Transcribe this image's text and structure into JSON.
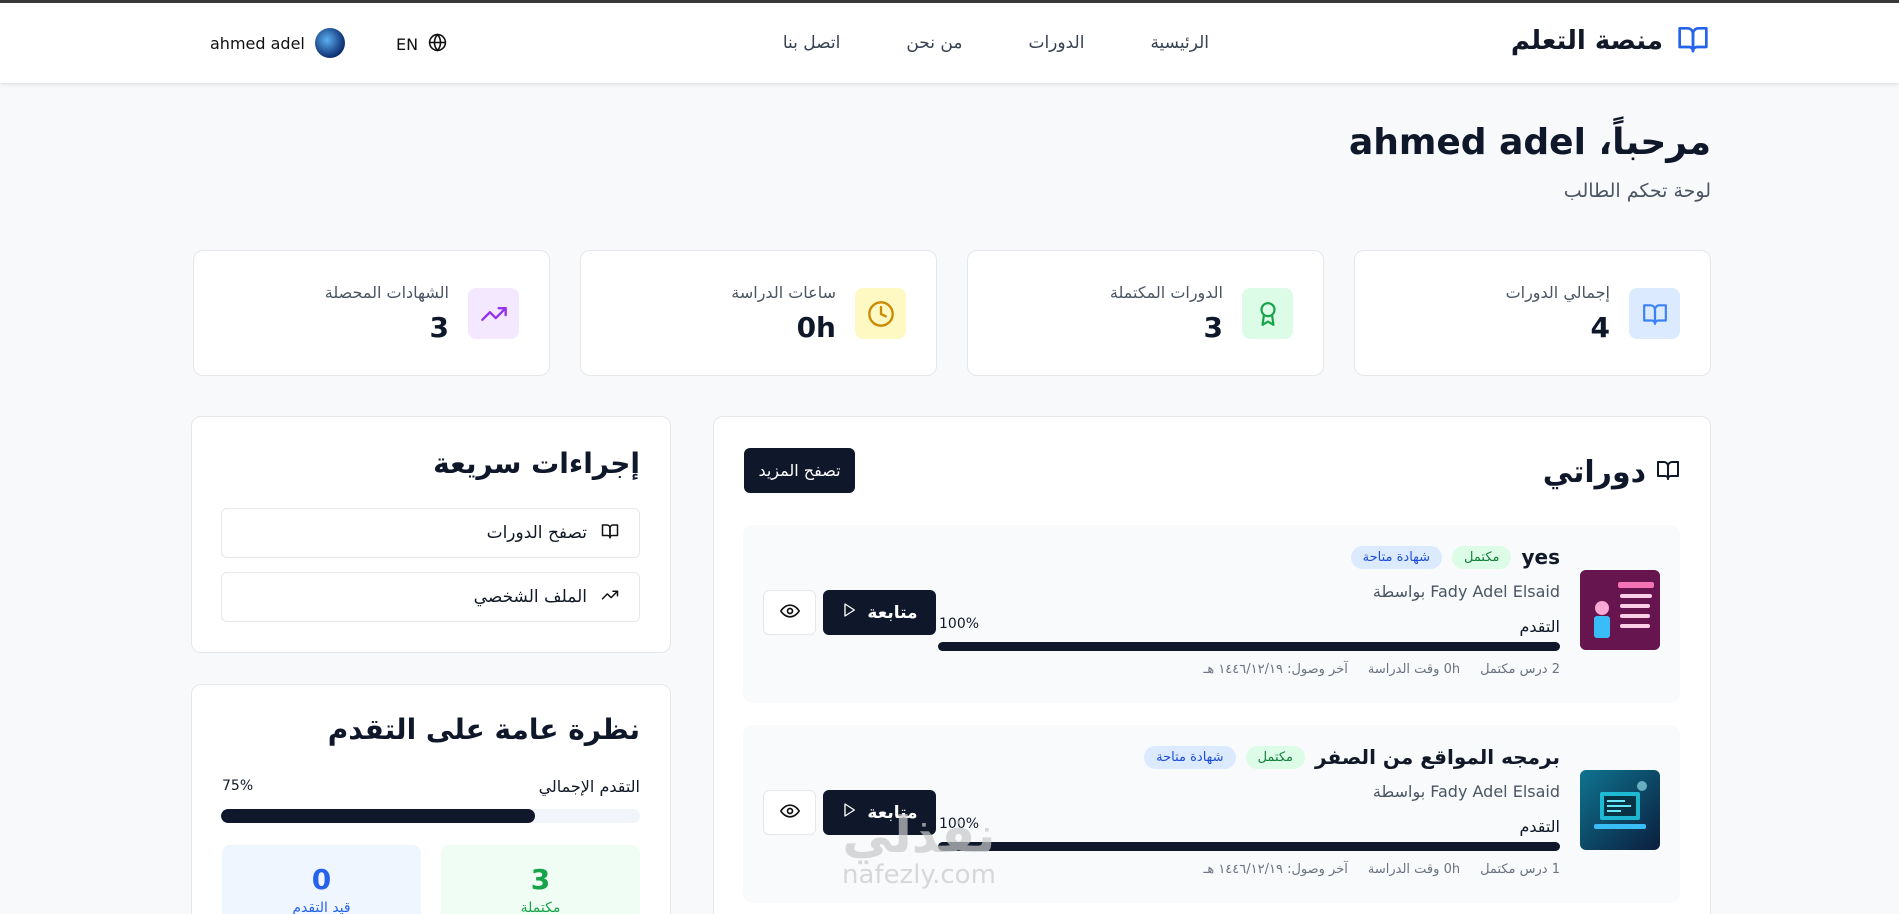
{
  "header": {
    "logo_text": "منصة التعلم",
    "nav": [
      "الرئيسية",
      "الدورات",
      "من نحن",
      "اتصل بنا"
    ],
    "lang": "EN",
    "user_name": "ahmed adel"
  },
  "welcome": {
    "title": "مرحباً، ahmed adel",
    "subtitle": "لوحة تحكم الطالب"
  },
  "stats": [
    {
      "label": "إجمالي الدورات",
      "value": "4",
      "icon": "book-open-icon",
      "color": "#3b82f6"
    },
    {
      "label": "الدورات المكتملة",
      "value": "3",
      "icon": "award-icon",
      "color": "#16a34a"
    },
    {
      "label": "ساعات الدراسة",
      "value": "0h",
      "icon": "clock-icon",
      "color": "#ca8a04"
    },
    {
      "label": "الشهادات المحصلة",
      "value": "3",
      "icon": "trending-up-icon",
      "color": "#9333ea"
    }
  ],
  "courses": {
    "title": "دوراتي",
    "browse_more": "تصفح المزيد",
    "items": [
      {
        "title": "yes",
        "status": "مكتمل",
        "certificate": "شهادة متاحة",
        "instructor": "بواسطة Fady Adel Elsaid",
        "progress_label": "التقدم",
        "progress_text": "100%",
        "progress": 1.0,
        "lessons": "2 درس مكتمل",
        "study_time": "0h وقت الدراسة",
        "last_access": "آخر وصول: ١٤٤٦/١٢/١٩ هـ",
        "follow_label": "متابعة"
      },
      {
        "title": "برمجه المواقع من الصفر",
        "status": "مكتمل",
        "certificate": "شهادة متاحة",
        "instructor": "بواسطة Fady Adel Elsaid",
        "progress_label": "التقدم",
        "progress_text": "100%",
        "progress": 1.0,
        "lessons": "1 درس مكتمل",
        "study_time": "0h وقت الدراسة",
        "last_access": "آخر وصول: ١٤٤٦/١٢/١٩ هـ",
        "follow_label": "متابعة"
      }
    ]
  },
  "quick_actions": {
    "title": "إجراءات سريعة",
    "items": [
      {
        "label": "تصفح الدورات",
        "icon": "book-open-icon"
      },
      {
        "label": "الملف الشخصي",
        "icon": "trending-up-icon"
      }
    ]
  },
  "overview": {
    "title": "نظرة عامة على التقدم",
    "total_label": "التقدم الإجمالي",
    "total_text": "75%",
    "total": 0.75,
    "completed_value": "3",
    "completed_label": "مكتملة",
    "in_progress_value": "0",
    "in_progress_label": "قيد التقدم"
  },
  "watermark": {
    "arabic": "نفذلي",
    "latin": "nafezly.com"
  }
}
